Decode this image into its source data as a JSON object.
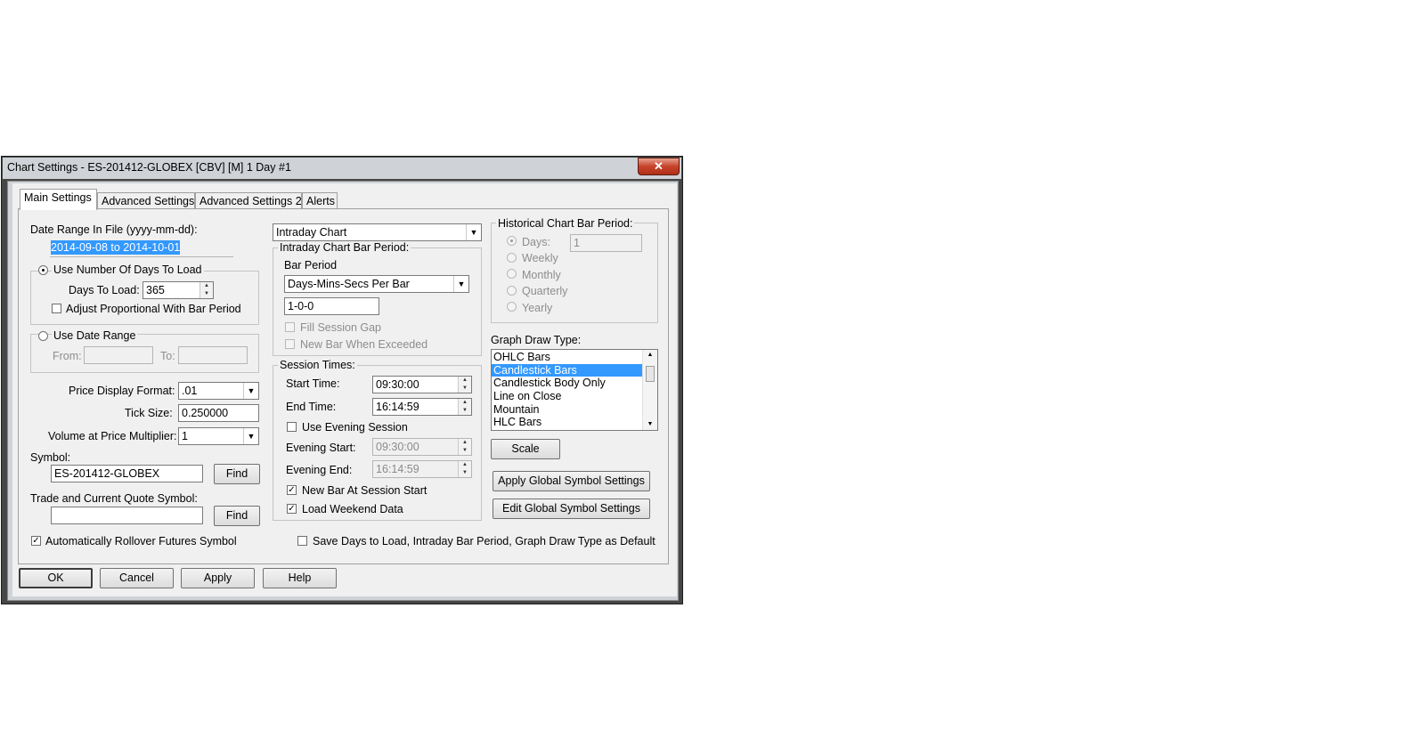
{
  "window": {
    "title": "Chart Settings - ES-201412-GLOBEX [CBV] [M]  1 Day   #1",
    "close_glyph": "✕"
  },
  "tabs": [
    "Main Settings",
    "Advanced Settings",
    "Advanced Settings 2",
    "Alerts"
  ],
  "left": {
    "date_range_label": "Date Range In File (yyyy-mm-dd):",
    "date_range_value": "2014-09-08 to 2014-10-01",
    "use_days_label": "Use Number Of Days To Load",
    "days_to_load_label": "Days To Load:",
    "days_to_load_value": "365",
    "adjust_label": "Adjust Proportional With Bar Period",
    "use_date_range_label": "Use Date Range",
    "from_label": "From:",
    "to_label": "To:",
    "price_format_label": "Price Display Format:",
    "price_format_value": ".01",
    "tick_size_label": "Tick Size:",
    "tick_size_value": "0.250000",
    "vap_label": "Volume at Price Multiplier:",
    "vap_value": "1",
    "symbol_label": "Symbol:",
    "symbol_value": "ES-201412-GLOBEX",
    "find_label": "Find",
    "trade_symbol_label": "Trade and Current Quote Symbol:",
    "trade_symbol_value": "",
    "find2_label": "Find",
    "rollover_label": "Automatically Rollover Futures Symbol"
  },
  "middle": {
    "chart_type_value": "Intraday Chart",
    "intraday_group_label": "Intraday Chart Bar Period:",
    "bar_period_label": "Bar Period",
    "bar_period_value": "Days-Mins-Secs Per Bar",
    "bar_period_text": "1-0-0",
    "fill_gap_label": "Fill Session Gap",
    "new_bar_exceeded_label": "New Bar When Exceeded",
    "session_group_label": "Session Times:",
    "start_time_label": "Start Time:",
    "start_time_value": "09:30:00",
    "end_time_label": "End Time:",
    "end_time_value": "16:14:59",
    "use_evening_label": "Use Evening Session",
    "evening_start_label": "Evening Start:",
    "evening_start_value": "09:30:00",
    "evening_end_label": "Evening End:",
    "evening_end_value": "16:14:59",
    "new_bar_session_label": "New Bar At Session Start",
    "load_weekend_label": "Load Weekend Data",
    "save_default_label": "Save Days to Load, Intraday Bar Period, Graph Draw Type as Default"
  },
  "right": {
    "historical_group_label": "Historical Chart Bar Period:",
    "days_label": "Days:",
    "days_value": "1",
    "weekly_label": "Weekly",
    "monthly_label": "Monthly",
    "quarterly_label": "Quarterly",
    "yearly_label": "Yearly",
    "graph_draw_label": "Graph Draw Type:",
    "graph_draw_items": [
      "OHLC Bars",
      "Candlestick Bars",
      "Candlestick Body Only",
      "Line on Close",
      "Mountain",
      "HLC Bars"
    ],
    "scale_label": "Scale",
    "apply_global_label": "Apply Global Symbol Settings",
    "edit_global_label": "Edit Global Symbol Settings"
  },
  "footer": {
    "ok": "OK",
    "cancel": "Cancel",
    "apply": "Apply",
    "help": "Help"
  }
}
